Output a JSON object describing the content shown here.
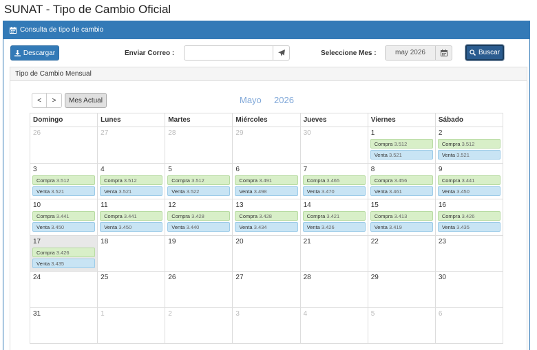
{
  "title": "SUNAT - Tipo de Cambio Oficial",
  "panel": {
    "heading": "Consulta de tipo de cambio",
    "download_label": "Descargar",
    "email_label": "Enviar Correo :",
    "email_value": "",
    "month_label": "Seleccione Mes :",
    "month_value": "may 2026",
    "search_label": "Buscar"
  },
  "monthly": {
    "heading": "Tipo de Cambio Mensual",
    "prev_label": "<",
    "next_label": ">",
    "current_label": "Mes Actual",
    "month_name": "Mayo",
    "year": "2026"
  },
  "calendar": {
    "weekdays": [
      "Domingo",
      "Lunes",
      "Martes",
      "Miércoles",
      "Jueves",
      "Viernes",
      "Sábado"
    ],
    "compra_label": "Compra",
    "venta_label": "Venta",
    "weeks": [
      [
        {
          "day": "26",
          "other": true
        },
        {
          "day": "27",
          "other": true
        },
        {
          "day": "28",
          "other": true
        },
        {
          "day": "29",
          "other": true
        },
        {
          "day": "30",
          "other": true
        },
        {
          "day": "1",
          "compra": "3.512",
          "venta": "3.521"
        },
        {
          "day": "2",
          "compra": "3.512",
          "venta": "3.521"
        }
      ],
      [
        {
          "day": "3",
          "compra": "3.512",
          "venta": "3.521"
        },
        {
          "day": "4",
          "compra": "3.512",
          "venta": "3.521"
        },
        {
          "day": "5",
          "compra": "3.512",
          "venta": "3.522"
        },
        {
          "day": "6",
          "compra": "3.491",
          "venta": "3.498"
        },
        {
          "day": "7",
          "compra": "3.465",
          "venta": "3.470"
        },
        {
          "day": "8",
          "compra": "3.456",
          "venta": "3.461"
        },
        {
          "day": "9",
          "compra": "3.441",
          "venta": "3.450"
        }
      ],
      [
        {
          "day": "10",
          "compra": "3.441",
          "venta": "3.450"
        },
        {
          "day": "11",
          "compra": "3.441",
          "venta": "3.450"
        },
        {
          "day": "12",
          "compra": "3.428",
          "venta": "3.440"
        },
        {
          "day": "13",
          "compra": "3.428",
          "venta": "3.434"
        },
        {
          "day": "14",
          "compra": "3.421",
          "venta": "3.426"
        },
        {
          "day": "15",
          "compra": "3.413",
          "venta": "3.419"
        },
        {
          "day": "16",
          "compra": "3.426",
          "venta": "3.435"
        }
      ],
      [
        {
          "day": "17",
          "compra": "3.426",
          "venta": "3.435",
          "today": true
        },
        {
          "day": "18"
        },
        {
          "day": "19"
        },
        {
          "day": "20"
        },
        {
          "day": "21"
        },
        {
          "day": "22"
        },
        {
          "day": "23"
        }
      ],
      [
        {
          "day": "24"
        },
        {
          "day": "25"
        },
        {
          "day": "26"
        },
        {
          "day": "27"
        },
        {
          "day": "28"
        },
        {
          "day": "29"
        },
        {
          "day": "30"
        }
      ],
      [
        {
          "day": "31"
        },
        {
          "day": "1",
          "other": true
        },
        {
          "day": "2",
          "other": true
        },
        {
          "day": "3",
          "other": true
        },
        {
          "day": "4",
          "other": true
        },
        {
          "day": "5",
          "other": true
        },
        {
          "day": "6",
          "other": true
        }
      ]
    ]
  },
  "colors": {
    "primary": "#337ab7",
    "compra_bg": "#d8efc8",
    "venta_bg": "#c8e4f4",
    "month_title": "#7fa7d8"
  },
  "icons": {
    "heading": "calendar-icon",
    "download": "download-icon",
    "send": "paper-plane-icon",
    "month_picker": "calendar-icon",
    "search": "search-icon"
  }
}
